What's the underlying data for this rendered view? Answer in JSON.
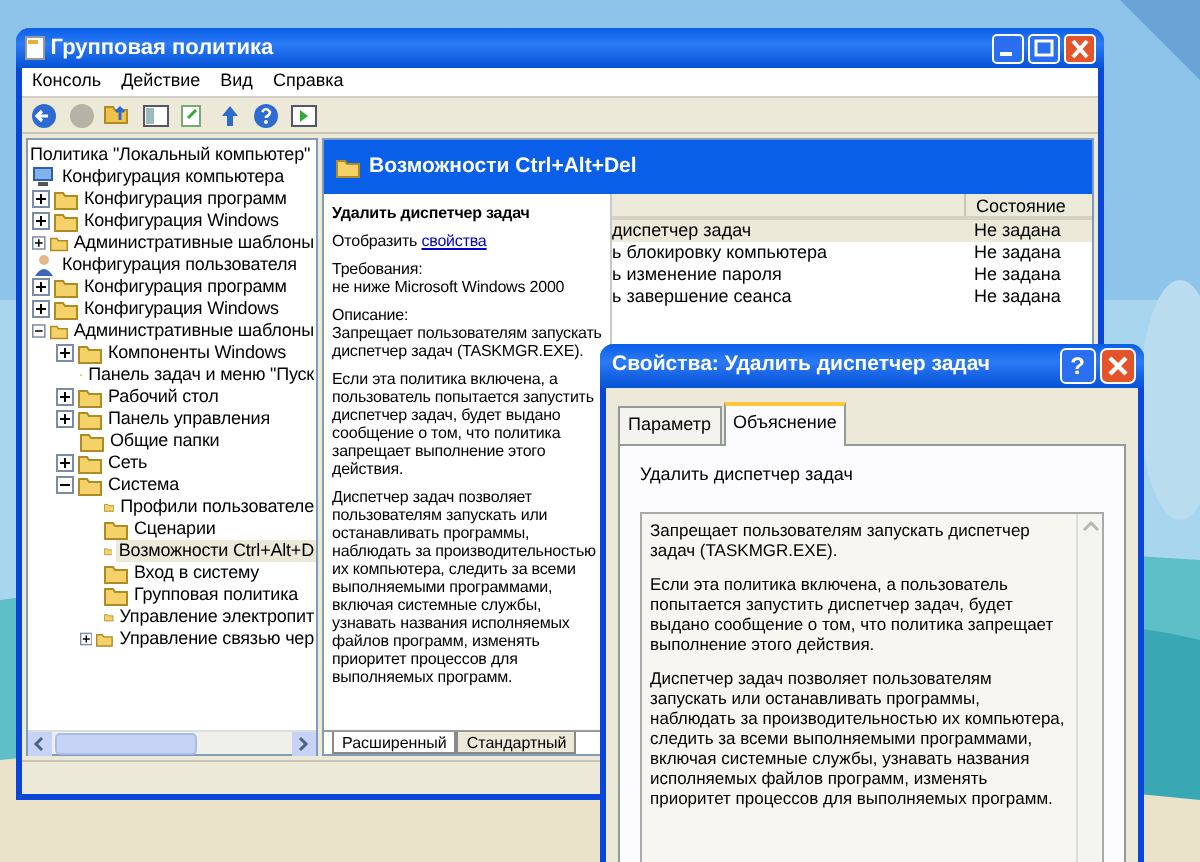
{
  "main_window": {
    "title": "Групповая политика",
    "menu": [
      "Консоль",
      "Действие",
      "Вид",
      "Справка"
    ],
    "tree": [
      {
        "label": "Политика \"Локальный компьютер\"",
        "selected": false,
        "children": [
          {
            "label": "Конфигурация компьютера",
            "kind": "computer",
            "selected": false,
            "children": [
              {
                "label": "Конфигурация программ",
                "kind": "folder",
                "expanded": false,
                "selected": false
              },
              {
                "label": "Конфигурация Windows",
                "kind": "folder",
                "expanded": false,
                "selected": false
              },
              {
                "label": "Административные шаблоны",
                "kind": "folder",
                "expanded": false,
                "selected": false
              }
            ]
          },
          {
            "label": "Конфигурация пользователя",
            "kind": "user",
            "selected": false,
            "children": [
              {
                "label": "Конфигурация программ",
                "kind": "folder",
                "expanded": false,
                "selected": false
              },
              {
                "label": "Конфигурация Windows",
                "kind": "folder",
                "expanded": false,
                "selected": false
              },
              {
                "label": "Административные шаблоны",
                "kind": "folder",
                "expanded": true,
                "selected": false,
                "children": [
                  {
                    "label": "Компоненты Windows",
                    "kind": "folder",
                    "expanded": false,
                    "selected": false
                  },
                  {
                    "label": "Панель задач и меню \"Пуск",
                    "kind": "folder",
                    "selected": false
                  },
                  {
                    "label": "Рабочий стол",
                    "kind": "folder",
                    "expanded": false,
                    "selected": false
                  },
                  {
                    "label": "Панель управления",
                    "kind": "folder",
                    "expanded": false,
                    "selected": false
                  },
                  {
                    "label": "Общие папки",
                    "kind": "folder",
                    "selected": false
                  },
                  {
                    "label": "Сеть",
                    "kind": "folder",
                    "expanded": false,
                    "selected": false
                  },
                  {
                    "label": "Система",
                    "kind": "folder",
                    "expanded": true,
                    "selected": false,
                    "children": [
                      {
                        "label": "Профили пользователе",
                        "kind": "folder",
                        "selected": false
                      },
                      {
                        "label": "Сценарии",
                        "kind": "folder",
                        "selected": false
                      },
                      {
                        "label": "Возможности Ctrl+Alt+D",
                        "kind": "folder",
                        "selected": true
                      },
                      {
                        "label": "Вход в систему",
                        "kind": "folder",
                        "selected": false
                      },
                      {
                        "label": "Групповая политика",
                        "kind": "folder",
                        "selected": false
                      },
                      {
                        "label": "Управление электропит",
                        "kind": "folder",
                        "selected": false
                      },
                      {
                        "label": "Управление связью чер",
                        "kind": "folder",
                        "expanded": false,
                        "selected": false
                      }
                    ]
                  }
                ]
              }
            ]
          }
        ]
      }
    ],
    "header": "Возможности Ctrl+Alt+Del",
    "description": {
      "title": "Удалить диспетчер задач",
      "show_prefix": "Отобразить",
      "show_link": "свойства",
      "requirements_label": "Требования:",
      "requirements": "не ниже Microsoft Windows 2000",
      "description_label": "Описание:",
      "paragraphs": [
        "Запрещает пользователям запускать диспетчер задач (TASKMGR.EXE).",
        "Если эта политика включена, а пользователь попытается запустить диспетчер задач, будет выдано сообщение о том, что политика запрещает выполнение этого действия.",
        "Диспетчер задач позволяет пользователям запускать или останавливать программы, наблюдать за производительностью их компьютера, следить за всеми выполняемыми программами, включая системные службы, узнавать названия исполняемых файлов программ, изменять приоритет процессов для выполняемых программ."
      ]
    },
    "view_tabs": [
      {
        "label": "Расширенный",
        "selected": true
      },
      {
        "label": "Стандартный",
        "selected": false
      }
    ],
    "list": {
      "columns": [
        "Состояние"
      ],
      "rows": [
        {
          "name": "диспетчер задач",
          "state": "Не задана",
          "selected": true
        },
        {
          "name": "ь блокировку компьютера",
          "state": "Не задана",
          "selected": false
        },
        {
          "name": "ь изменение пароля",
          "state": "Не задана",
          "selected": false
        },
        {
          "name": "ь завершение сеанса",
          "state": "Не задана",
          "selected": false
        }
      ]
    }
  },
  "dialog": {
    "title": "Свойства: Удалить диспетчер задач",
    "help_button": "?",
    "tabs": [
      {
        "label": "Параметр",
        "selected": false
      },
      {
        "label": "Объяснение",
        "selected": true
      }
    ],
    "policy_name": "Удалить диспетчер задач",
    "explanation": [
      "Запрещает пользователям запускать диспетчер задач (TASKMGR.EXE).",
      "Если эта политика включена, а пользователь попытается запустить диспетчер задач, будет выдано сообщение о том, что политика запрещает выполнение этого действия.",
      "Диспетчер задач позволяет пользователям запускать или останавливать программы, наблюдать за производительностью их компьютера, следить за всеми выполняемыми программами, включая системные службы, узнавать названия исполняемых файлов программ, изменять приоритет процессов для выполняемых программ."
    ]
  }
}
